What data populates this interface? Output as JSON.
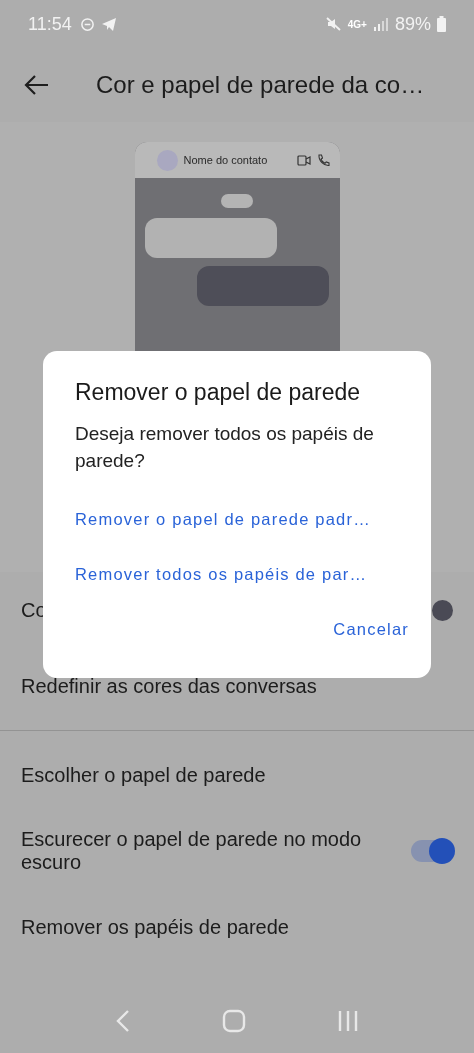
{
  "status_bar": {
    "time": "11:54",
    "network": "4G+",
    "battery": "89%"
  },
  "header": {
    "title": "Cor e papel de parede da co…"
  },
  "preview": {
    "contact_name": "Nome do contato"
  },
  "sections": [
    {
      "items": [
        {
          "kind": "color",
          "label": "Co",
          "color": "#4a4a55"
        },
        {
          "kind": "plain",
          "label": "Redefinir as cores das conversas"
        }
      ]
    },
    {
      "items": [
        {
          "kind": "plain",
          "label": "Escolher o papel de parede"
        },
        {
          "kind": "toggle",
          "label": "Escurecer o papel de parede no modo escuro",
          "on": true
        },
        {
          "kind": "plain",
          "label": "Remover os papéis de parede"
        }
      ]
    }
  ],
  "dialog": {
    "title": "Remover o papel de parede",
    "message": "Deseja remover todos os papéis de parede?",
    "options": [
      "Remover o papel de parede padr…",
      "Remover todos os papéis de par…"
    ],
    "cancel": "Cancelar"
  }
}
